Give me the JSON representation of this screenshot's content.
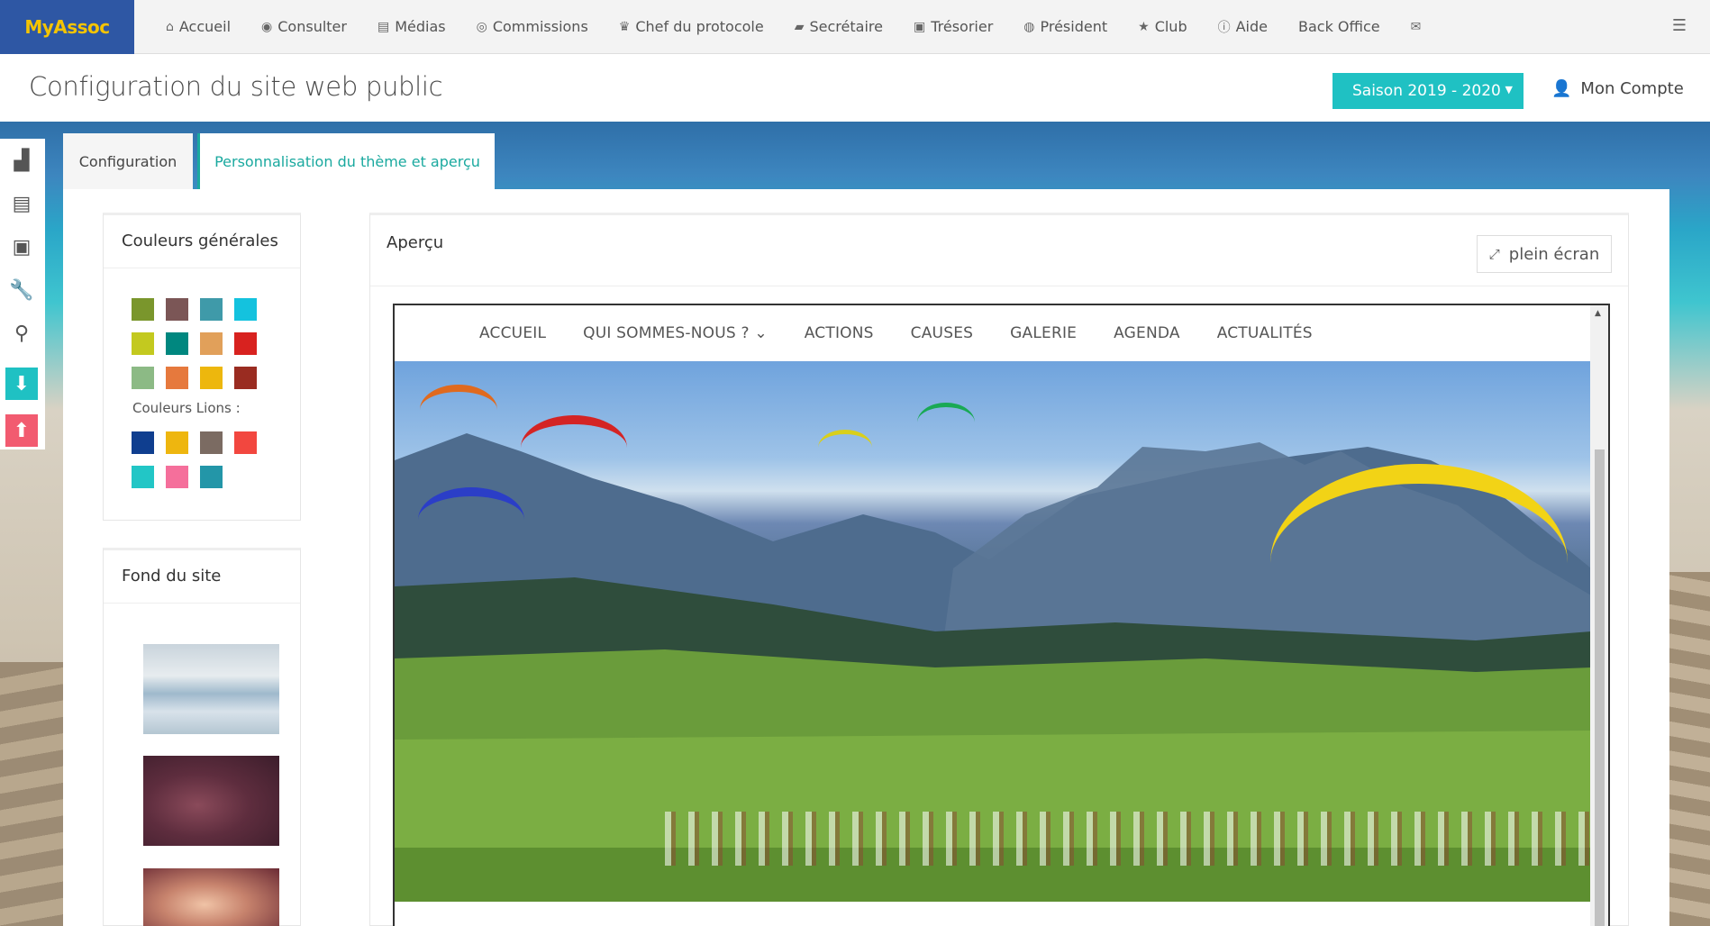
{
  "brand": "MyAssoc",
  "nav": [
    {
      "icon": "home-icon",
      "glyph": "⌂",
      "label": "Accueil"
    },
    {
      "icon": "eye-icon",
      "glyph": "◉",
      "label": "Consulter"
    },
    {
      "icon": "file-icon",
      "glyph": "▤",
      "label": "Médias"
    },
    {
      "icon": "user-circle-icon",
      "glyph": "◎",
      "label": "Commissions"
    },
    {
      "icon": "trophy-icon",
      "glyph": "♛",
      "label": "Chef du protocole"
    },
    {
      "icon": "book-icon",
      "glyph": "▰",
      "label": "Secrétaire"
    },
    {
      "icon": "money-icon",
      "glyph": "▣",
      "label": "Trésorier"
    },
    {
      "icon": "globe-icon",
      "glyph": "◍",
      "label": "Président"
    },
    {
      "icon": "star-icon",
      "glyph": "★",
      "label": "Club"
    },
    {
      "icon": "info-icon",
      "glyph": "ⓘ",
      "label": "Aide"
    },
    {
      "icon": "",
      "glyph": "",
      "label": "Back Office"
    },
    {
      "icon": "envelope-icon",
      "glyph": "✉",
      "label": ""
    }
  ],
  "header": {
    "title": "Configuration du site web public",
    "season": "Saison 2019 - 2020",
    "account": "Mon Compte"
  },
  "tabs": {
    "config": "Configuration",
    "theme": "Personnalisation du thème et aperçu"
  },
  "colors_box": {
    "title": "Couleurs générales",
    "general": [
      "#7a962c",
      "#7b5656",
      "#3f9aa9",
      "#14c2de",
      "#c3c91f",
      "#00877f",
      "#e1a05a",
      "#d8221f",
      "#8cba85",
      "#e6793d",
      "#edb70d",
      "#9a2c21"
    ],
    "lions_label": "Couleurs Lions :",
    "lions": [
      "#0f3e8f",
      "#eeb60f",
      "#7b6b62",
      "#f2473f",
      "#22c6c6",
      "#f56f9b",
      "#2396a8"
    ]
  },
  "fond_box": {
    "title": "Fond du site"
  },
  "preview": {
    "title": "Aperçu",
    "fullscreen": "plein écran",
    "site_nav": [
      "ACCUEIL",
      "QUI SOMMES-NOUS ? ⌄",
      "ACTIONS",
      "CAUSES",
      "GALERIE",
      "AGENDA",
      "ACTUALITÉS"
    ]
  }
}
